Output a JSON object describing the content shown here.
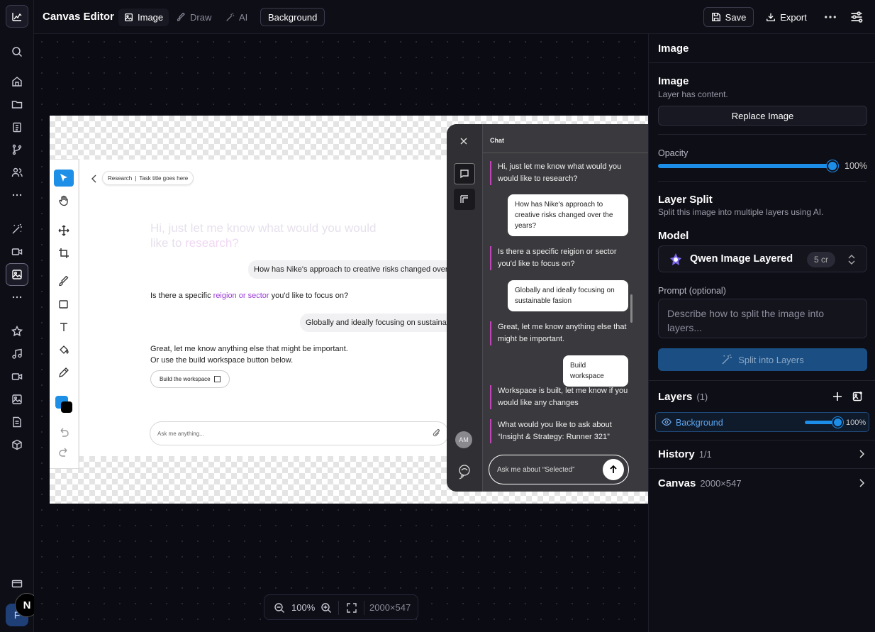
{
  "topbar": {
    "title": "Canvas Editor",
    "tabs": [
      {
        "label": "Image",
        "icon": "image-icon",
        "active": true
      },
      {
        "label": "Draw",
        "icon": "brush-icon",
        "active": false
      },
      {
        "label": "AI",
        "icon": "magic-wand-icon",
        "active": false
      }
    ],
    "layer_chip": "Background",
    "save_label": "Save",
    "export_label": "Export"
  },
  "canvas": {
    "zoom": "100%",
    "dimensions": "2000×547",
    "artboard": {
      "breadcrumb_research": "Research",
      "breadcrumb_task": "Task title goes here",
      "ghost_heading_1": "Hi, just let me know what would you would",
      "ghost_heading_2a": "like to ",
      "ghost_heading_2b": "research?",
      "bubble_1": "How has Nike's approach to creative risks changed over the",
      "question_1a": "Is there a specific ",
      "question_1b": "reigion or sector",
      "question_1c": " you'd like to focus on?",
      "bubble_2": "Globally and ideally focusing on sustainable",
      "note_1": "Great, let me know anything else that might be important.",
      "note_2": "Or use the build workspace button below.",
      "build_button": "Build the workspace",
      "ask_placeholder": "Ask me anything..."
    },
    "chat": {
      "title": "Chat",
      "messages": [
        {
          "role": "ai",
          "text": "Hi, just let me know what would you would like to research?"
        },
        {
          "role": "user",
          "text": "How has Nike's approach to creative risks changed over the years?"
        },
        {
          "role": "ai",
          "text": "Is there a specific reigion or sector you'd like to focus on?"
        },
        {
          "role": "user",
          "text": "Globally and ideally focusing on sustainable fasion"
        },
        {
          "role": "ai",
          "text": "Great, let me know anything else that might be important."
        },
        {
          "role": "user",
          "text": "Build workspace"
        },
        {
          "role": "ai",
          "text": "Workspace is built, let me know if you would like any changes"
        },
        {
          "role": "ai",
          "text": "What would you like to ask about “Insight & Strategy: Runner 321”"
        }
      ],
      "user_initials": "AM",
      "input_placeholder": "Ask me about “Selected”"
    }
  },
  "panel": {
    "header": "Image",
    "image_section": {
      "title": "Image",
      "subtitle": "Layer has content.",
      "replace_label": "Replace Image"
    },
    "opacity": {
      "label": "Opacity",
      "value": 100,
      "display": "100%"
    },
    "layer_split": {
      "title": "Layer Split",
      "subtitle": "Split this image into multiple layers using AI.",
      "model_label": "Model",
      "model_name": "Qwen Image Layered",
      "model_cost": "5 cr",
      "prompt_label": "Prompt (optional)",
      "prompt_placeholder": "Describe how to split the image into layers...",
      "split_label": "Split into Layers"
    },
    "layers": {
      "title": "Layers",
      "count": "(1)",
      "items": [
        {
          "name": "Background",
          "opacity": 100,
          "display": "100%"
        }
      ]
    },
    "history": {
      "title": "History",
      "value": "1/1"
    },
    "canvas_info": {
      "title": "Canvas",
      "value": "2000×547"
    }
  },
  "user": {
    "initial": "N",
    "workspace_initial": "F"
  },
  "colors": {
    "accent": "#1d8ee8",
    "split_button": "#1b4f83",
    "chat_accent": "#c144b8"
  }
}
